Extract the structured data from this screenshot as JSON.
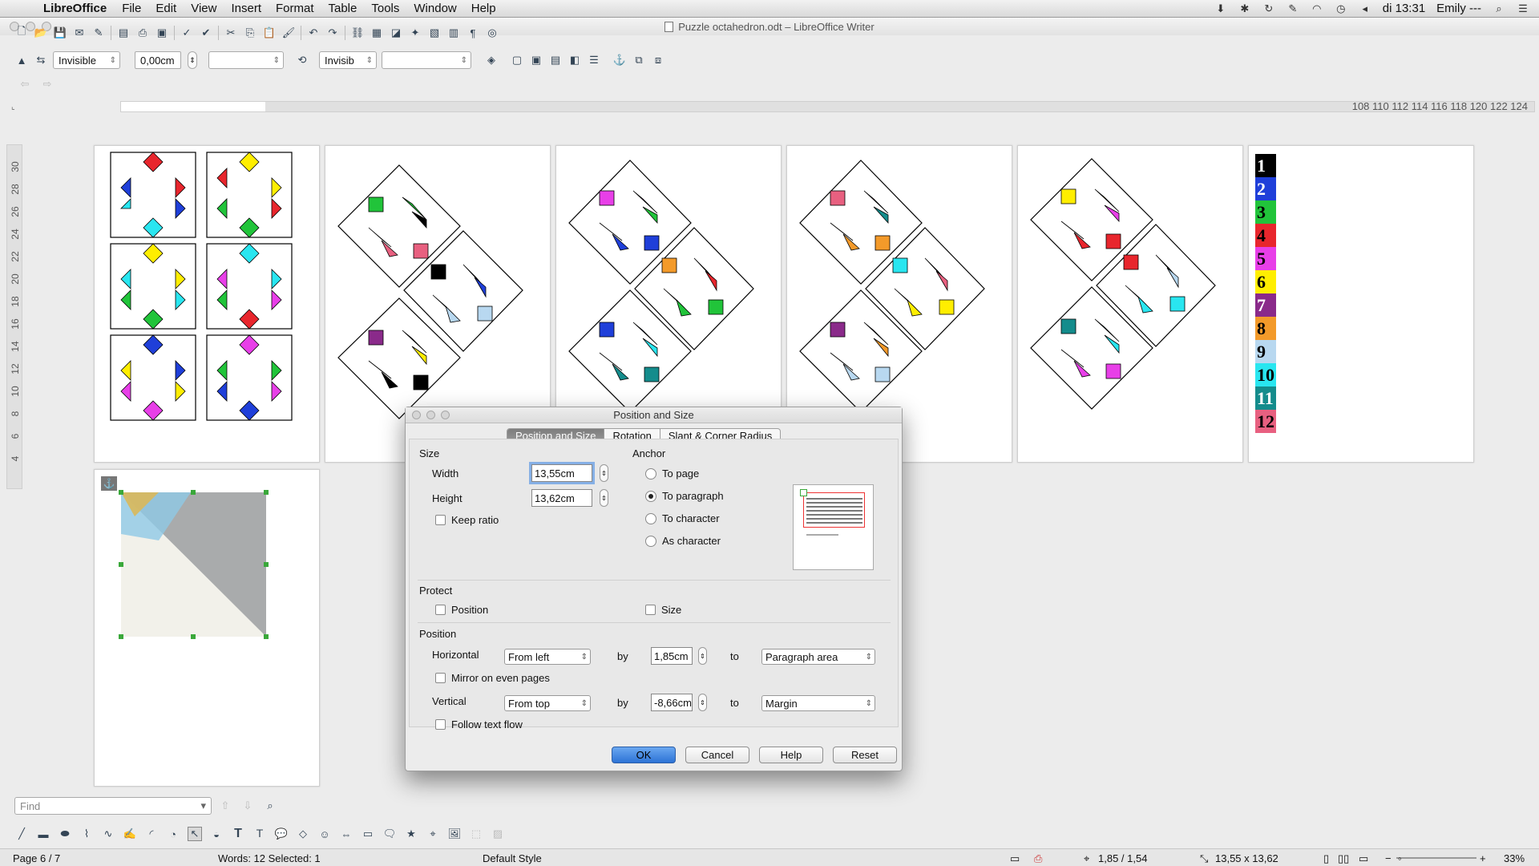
{
  "menubar": {
    "app": "LibreOffice",
    "items": [
      "File",
      "Edit",
      "View",
      "Insert",
      "Format",
      "Table",
      "Tools",
      "Window",
      "Help"
    ],
    "clock": "di 13:31",
    "user": "Emily ---"
  },
  "window": {
    "title": "Puzzle octahedron.odt – LibreOffice Writer"
  },
  "toolbar2": {
    "line_style": "Invisible",
    "line_width": "0,00cm",
    "area_style": "Invisib"
  },
  "ruler": {
    "h_ticks": "108 110 112 114 116 118 120 122 124",
    "v_ticks": [
      "30",
      "28",
      "26",
      "24",
      "22",
      "20",
      "18",
      "16",
      "14",
      "12",
      "10",
      "8",
      "6",
      "4"
    ]
  },
  "find": {
    "placeholder": "Find"
  },
  "status": {
    "page": "Page 6 / 7",
    "words": "Words: 12 Selected: 1",
    "style": "Default Style",
    "position": "1,85 / 1,54",
    "size": "13,55 x 13,62",
    "zoom": "33%"
  },
  "dialog": {
    "title": "Position and Size",
    "tabs": [
      "Position and Size",
      "Rotation",
      "Slant & Corner Radius"
    ],
    "size_section": "Size",
    "width_label": "Width",
    "width_value": "13,55cm",
    "height_label": "Height",
    "height_value": "13,62cm",
    "keep_ratio": "Keep ratio",
    "anchor_section": "Anchor",
    "anchor_options": [
      "To page",
      "To paragraph",
      "To character",
      "As character"
    ],
    "protect_section": "Protect",
    "protect_position": "Position",
    "protect_size": "Size",
    "position_section": "Position",
    "horizontal_label": "Horizontal",
    "horizontal_combo": "From left",
    "by": "by",
    "horizontal_by": "1,85cm",
    "to": "to",
    "horizontal_to": "Paragraph area",
    "mirror": "Mirror on even pages",
    "vertical_label": "Vertical",
    "vertical_combo": "From top",
    "vertical_by": "-8,66cm",
    "vertical_to": "Margin",
    "follow": "Follow text flow",
    "buttons": {
      "ok": "OK",
      "cancel": "Cancel",
      "help": "Help",
      "reset": "Reset"
    }
  },
  "legend": {
    "numbers": [
      "1",
      "2",
      "3",
      "4",
      "5",
      "6",
      "7",
      "8",
      "9",
      "10",
      "11",
      "12"
    ],
    "colors": [
      "#000000",
      "#1f3fd9",
      "#21c43a",
      "#e8262d",
      "#e83fe8",
      "#ffee00",
      "#8a2a8a",
      "#f39a2a",
      "#b8d8f0",
      "#29e6f0",
      "#148c8c",
      "#e86080"
    ]
  },
  "colors": {
    "accent": "#2d73d6",
    "selection_handle": "#3aa83a"
  }
}
